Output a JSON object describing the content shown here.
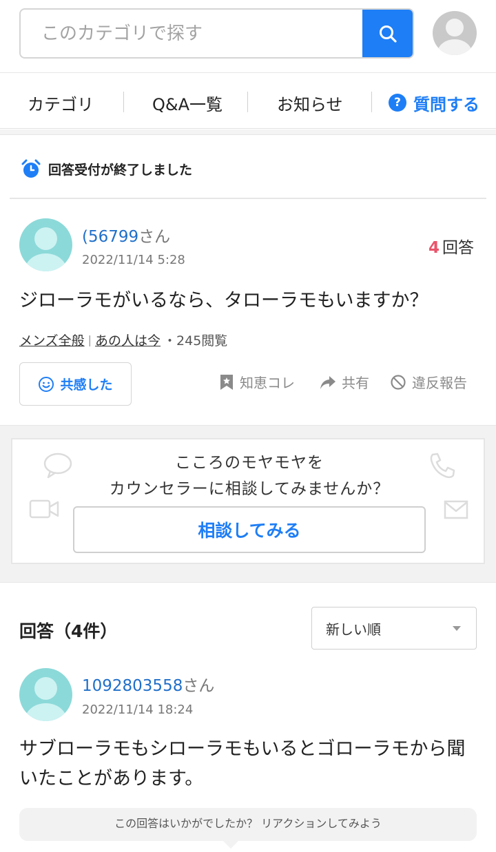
{
  "search": {
    "placeholder": "このカテゴリで探す"
  },
  "nav": {
    "items": [
      {
        "label": "カテゴリ"
      },
      {
        "label": "Q&A一覧"
      },
      {
        "label": "お知らせ"
      }
    ],
    "ask_label": "質問する",
    "ask_glyph": "?"
  },
  "status": {
    "text": "回答受付が終了しました"
  },
  "question": {
    "user_name": "(56799",
    "user_suffix": "さん",
    "date": "2022/11/14 5:28",
    "answer_count": "4",
    "answer_count_label": "回答",
    "text": "ジローラモがいるなら、タローラモもいますか？",
    "tags": [
      "メンズ全般",
      "あの人は今"
    ],
    "tag_separator": "|",
    "views": "・245閲覧",
    "empathy_label": "共感した",
    "actions": {
      "save": "知恵コレ",
      "share": "共有",
      "report": "違反報告"
    }
  },
  "counsel": {
    "line1": "こころのモヤモヤを",
    "line2": "カウンセラーに相談してみませんか？",
    "button": "相談してみる"
  },
  "answers": {
    "title": "回答（4件）",
    "sort_selected": "新しい順",
    "items": [
      {
        "user_name": "1092803558",
        "user_suffix": "さん",
        "date": "2022/11/14 18:24",
        "text": "サブローラモもシローラモもいるとゴローラモから聞いたことがあります。",
        "reaction_prompt": "この回答はいかがでしたか？ リアクションしてみよう"
      }
    ]
  },
  "colors": {
    "accent": "#1e7ef6",
    "answer_count": "#e9546b",
    "username": "#1f6fc9"
  },
  "icons": {
    "search": "search-icon",
    "alarm": "alarm-clock-icon",
    "smile": "smile-icon",
    "save": "bookmark-star-icon",
    "share": "share-arrow-icon",
    "report": "prohibited-icon",
    "chat": "speech-bubble-icon",
    "phone": "phone-icon",
    "video": "video-camera-icon",
    "mail": "mail-icon"
  }
}
